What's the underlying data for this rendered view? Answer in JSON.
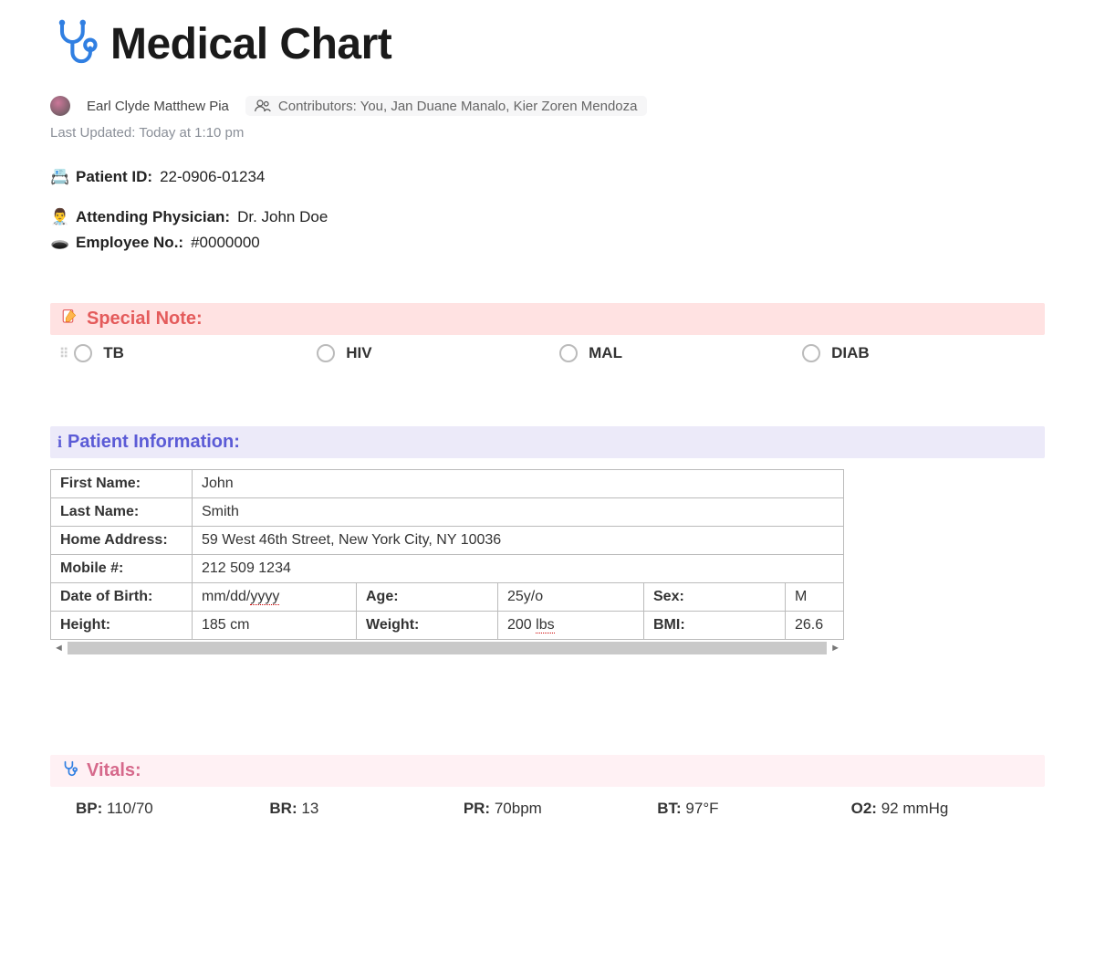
{
  "header": {
    "title": "Medical Chart",
    "author": "Earl Clyde Matthew Pia",
    "contributors_label": "Contributors:",
    "contributors": "You, Jan Duane Manalo, Kier Zoren Mendoza",
    "last_updated_label": "Last Updated:",
    "last_updated": "Today at 1:10 pm"
  },
  "ids": {
    "patient_id_label": "Patient ID:",
    "patient_id": "22-0906-01234",
    "physician_label": "Attending Physician:",
    "physician": "Dr. John Doe",
    "employee_label": "Employee No.:",
    "employee_no": "#0000000"
  },
  "special": {
    "heading": "Special Note:",
    "options": {
      "tb": "TB",
      "hiv": "HIV",
      "mal": "MAL",
      "diab": "DIAB"
    }
  },
  "patient_info": {
    "heading": "Patient Information:",
    "first_name_label": "First Name:",
    "first_name": "John",
    "last_name_label": "Last Name:",
    "last_name": "Smith",
    "address_label": "Home Address:",
    "address": "59 West 46th Street, New York City, NY 10036",
    "mobile_label": "Mobile #:",
    "mobile": "212 509 1234",
    "dob_label": "Date of Birth:",
    "dob_prefix": "mm/dd/",
    "dob_suffix": "yyyy",
    "age_label": "Age:",
    "age": "25y/o",
    "sex_label": "Sex:",
    "sex": "M",
    "height_label": "Height:",
    "height": "185 cm",
    "weight_label": "Weight:",
    "weight_prefix": "200 ",
    "weight_suffix": "lbs",
    "bmi_label": "BMI:",
    "bmi": "26.6"
  },
  "vitals": {
    "heading": "Vitals:",
    "bp_label": "BP:",
    "bp": "110/70",
    "br_label": "BR:",
    "br": "13",
    "pr_label": "PR:",
    "pr": "70bpm",
    "bt_label": "BT:",
    "bt": "97°F",
    "o2_label": "O2:",
    "o2": "92 mmHg"
  }
}
